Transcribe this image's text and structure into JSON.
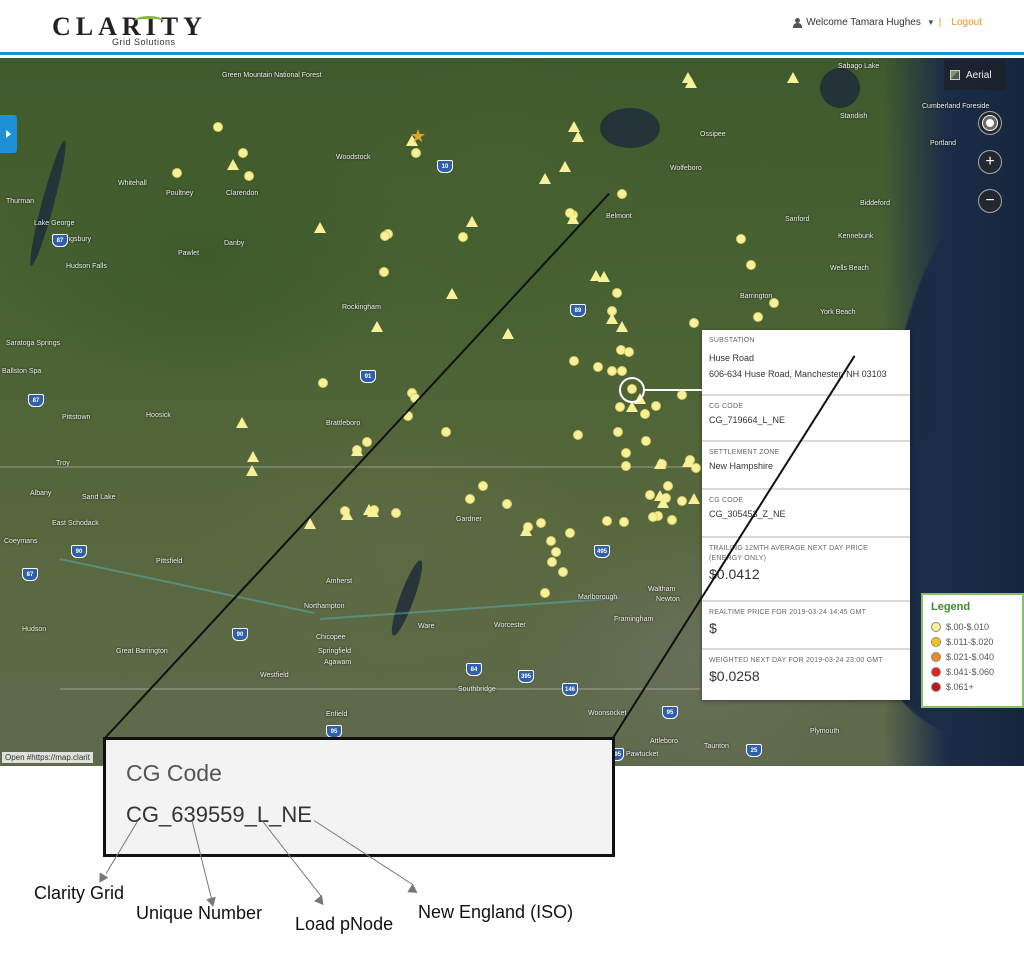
{
  "header": {
    "logo_text": "CLARITY",
    "logo_subtitle": "Grid Solutions",
    "welcome_text": "Welcome Tamara Hughes",
    "logout_separator": "|",
    "logout_label": "Logout"
  },
  "map": {
    "aerial_label": "Aerial",
    "attribution": "Open #https://map.clarit",
    "places": [
      "Sabago Lake",
      "Green Mountain National Forest",
      "Woodstock",
      "Whitehall",
      "Poultney",
      "Clarendon",
      "Thurman",
      "Lake George",
      "Kingsbury",
      "Pawlet",
      "Danby",
      "Hudson Falls",
      "Saratoga Springs",
      "Ballston Spa",
      "Pittstown",
      "Hoosick",
      "Troy",
      "Albany",
      "Sand Lake",
      "East Schodack",
      "Brattleboro",
      "Rockingham",
      "Belmont",
      "Wolfeboro",
      "Ossipee",
      "Sanford",
      "Biddeford",
      "Kennebunk",
      "Wells Beach",
      "York Beach",
      "Barrington",
      "Portland",
      "Cumberland Foreside",
      "Standish",
      "Gardner",
      "Pittsfield",
      "Northampton",
      "Amherst",
      "Ware",
      "Chicopee",
      "Springfield",
      "Agawam",
      "Westfield",
      "Great Barrington",
      "Hudson",
      "Coeymans",
      "Worcester",
      "Southbridge",
      "Marlborough",
      "Framingham",
      "Waltham",
      "Newton",
      "Woonsocket",
      "Attleboro",
      "Taunton",
      "Pawtucket",
      "Plymouth",
      "Enfield"
    ],
    "shields": [
      "10",
      "87",
      "91",
      "89",
      "87",
      "90",
      "495",
      "90",
      "84",
      "395",
      "146",
      "95",
      "95",
      "25",
      "495",
      "87"
    ]
  },
  "info_panel": {
    "substation_label": "SUBSTATION",
    "substation_name": "Huse Road",
    "substation_address": "606-634 Huse Road, Manchester, NH 03103",
    "cg_code_label_1": "CG CODE",
    "cg_code_1": "CG_719664_L_NE",
    "settlement_zone_label": "SETTLEMENT ZONE",
    "settlement_zone": "New Hampshire",
    "cg_code_label_2": "CG CODE",
    "cg_code_2": "CG_305453_Z_NE",
    "trailing_label": "TRAILING 12mth AVERAGE NEXT DAY PRICE (Energy only)",
    "trailing_value": "$0.0412",
    "realtime_label": "REALTIME PRICE FOR 2019-03-24 14:45 GMT",
    "realtime_value": "$",
    "weighted_label": "WEIGHTED NEXT DAY FOR 2019-03-24 23:00 GMT",
    "weighted_value": "$0.0258"
  },
  "legend": {
    "title": "Legend",
    "items": [
      {
        "label": "$.00-$.010",
        "color": "#f8f19a"
      },
      {
        "label": "$.011-$.020",
        "color": "#f0c419"
      },
      {
        "label": "$.021-$.040",
        "color": "#f08a1c"
      },
      {
        "label": "$.041-$.060",
        "color": "#e8231b"
      },
      {
        "label": "$.061+",
        "color": "#b81c1c"
      }
    ]
  },
  "callout": {
    "label": "CG Code",
    "code": "CG_639559_L_NE"
  },
  "annotations": {
    "part1": "Clarity Grid",
    "part2": "Unique Number",
    "part3": "Load pNode",
    "part4": "New England (ISO)"
  }
}
